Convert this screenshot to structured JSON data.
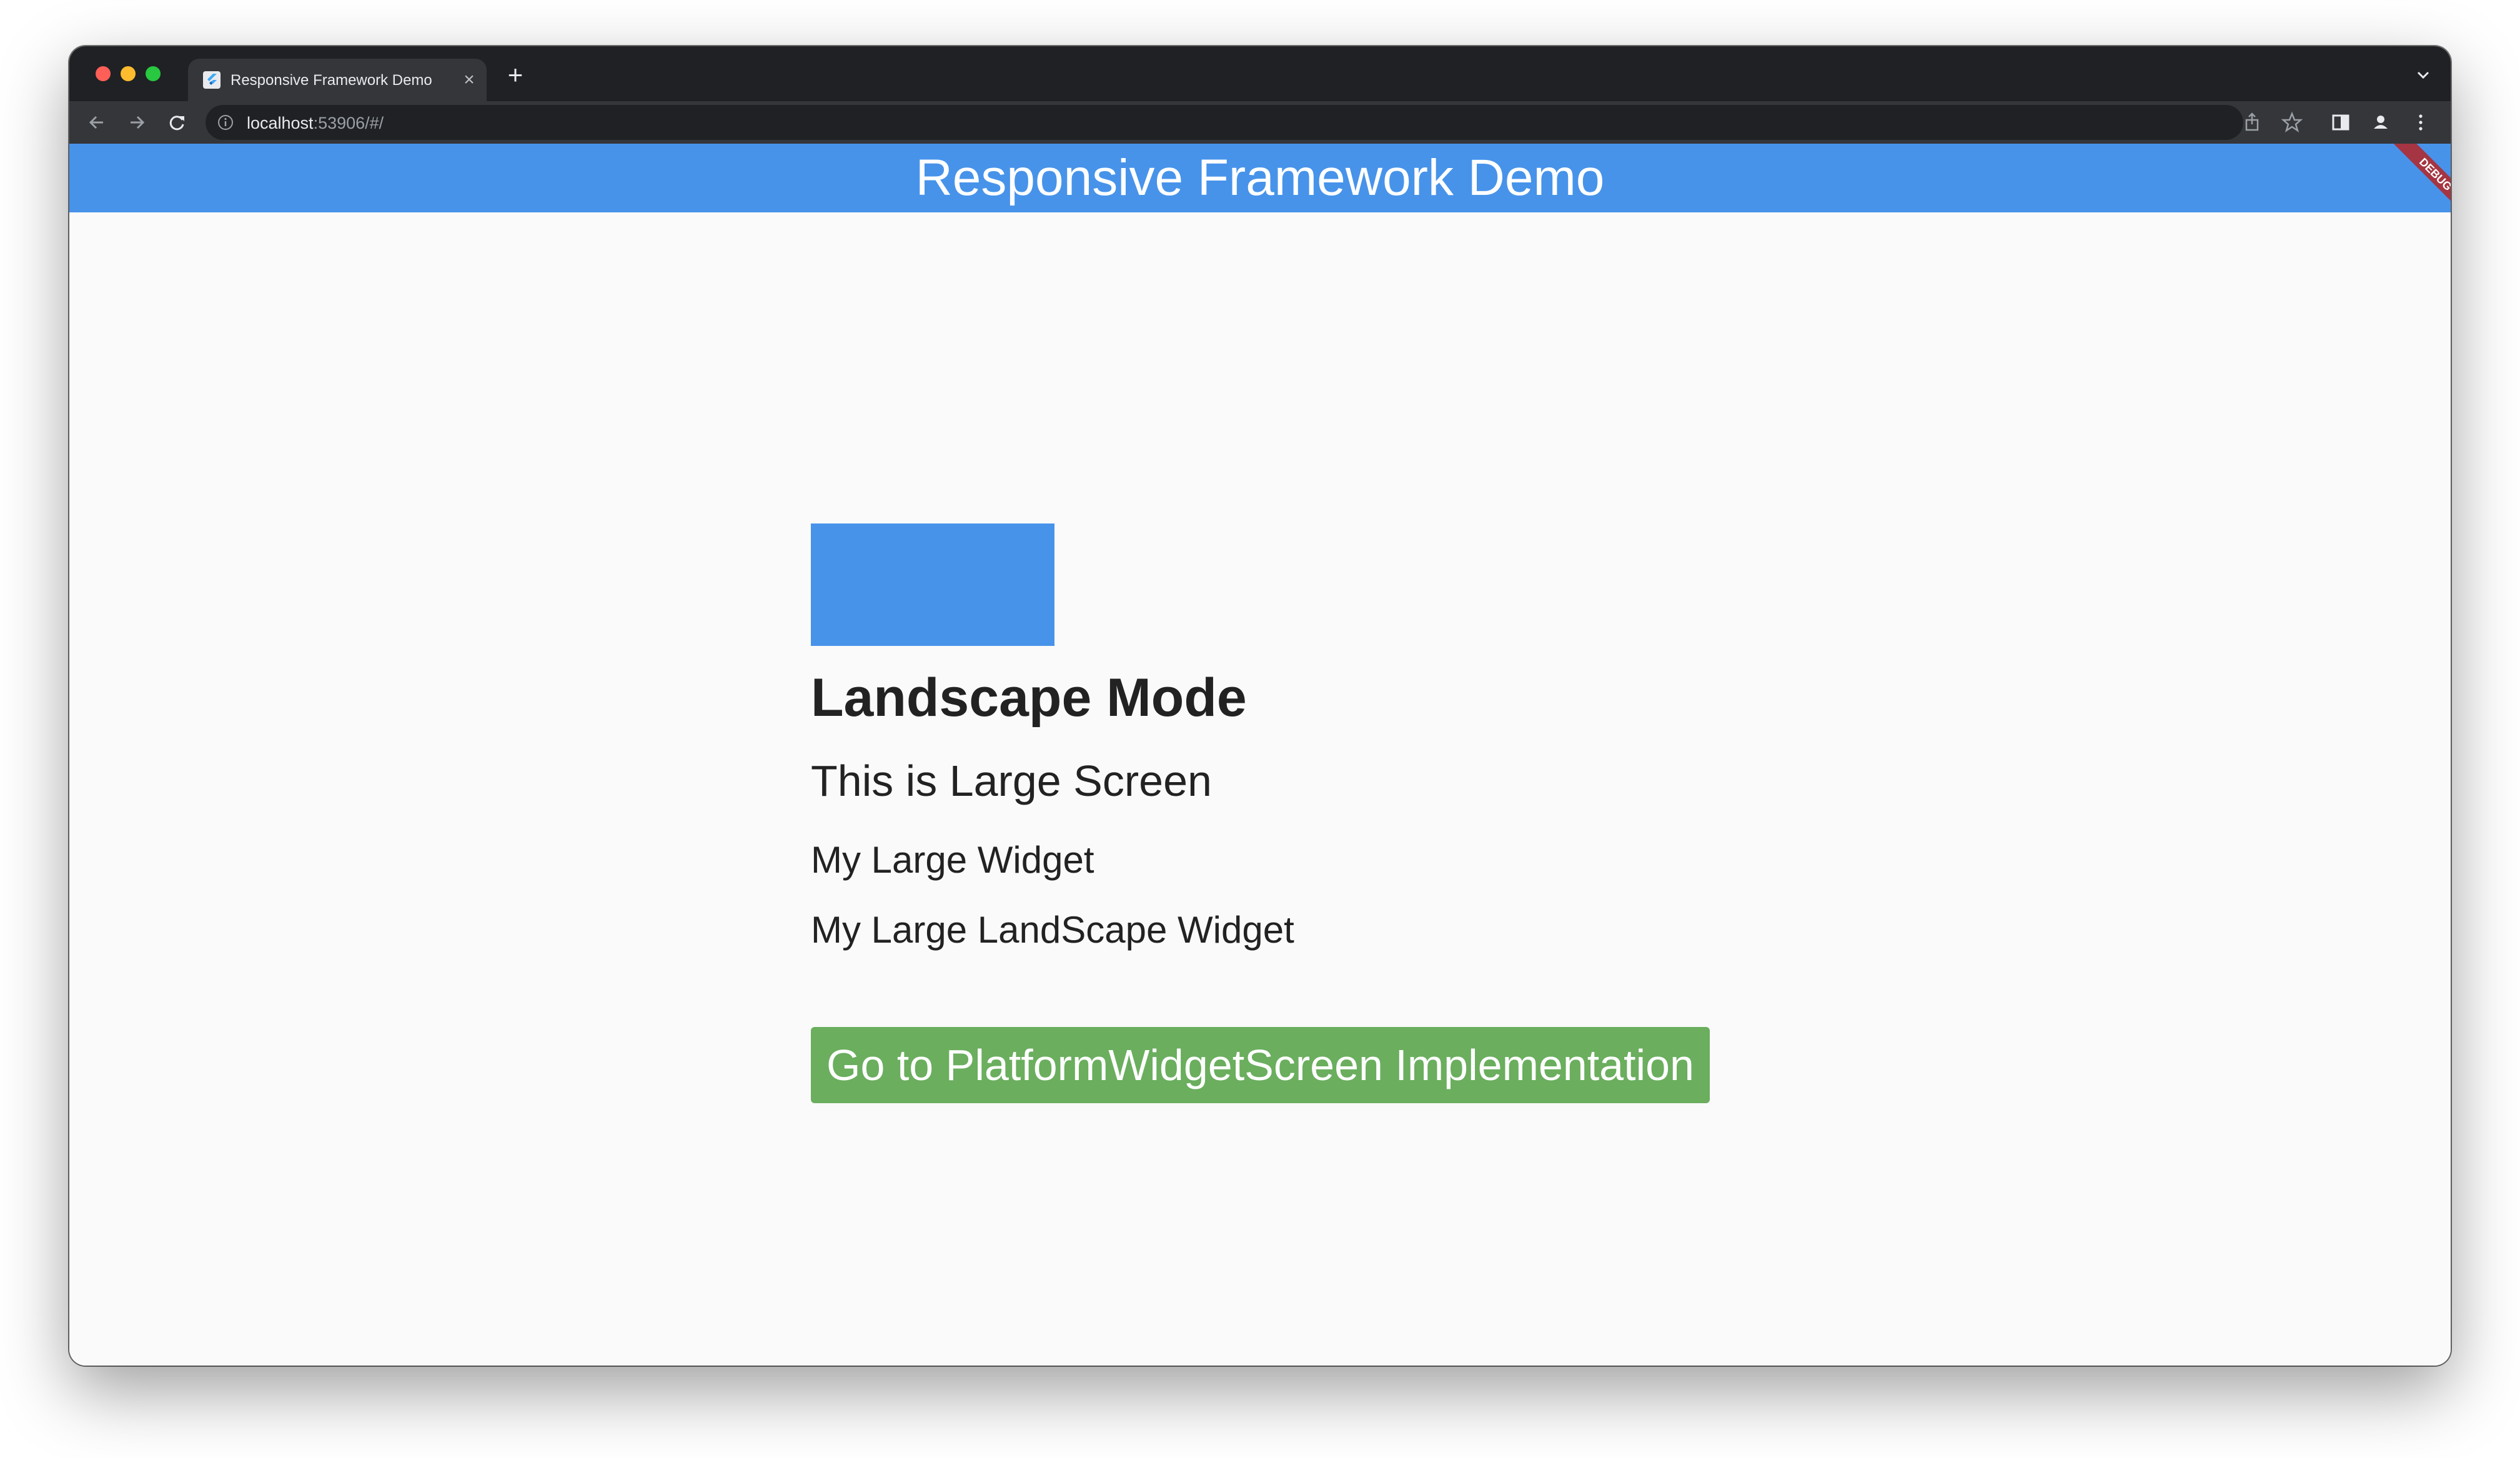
{
  "browser": {
    "tab": {
      "title": "Responsive Framework Demo",
      "favicon": "flutter-icon"
    },
    "address_bar": {
      "host": "localhost",
      "path": ":53906/#/"
    }
  },
  "app": {
    "title": "Responsive Framework Demo",
    "debug_banner": "DEBUG",
    "accent_color": "#4793ea",
    "button_color": "#6aae5e"
  },
  "content": {
    "heading": "Landscape Mode",
    "subheading": "This is Large Screen",
    "text_1": "My Large Widget",
    "text_2": "My Large LandScape Widget",
    "button_label": "Go to PlatformWidgetScreen Implementation"
  }
}
